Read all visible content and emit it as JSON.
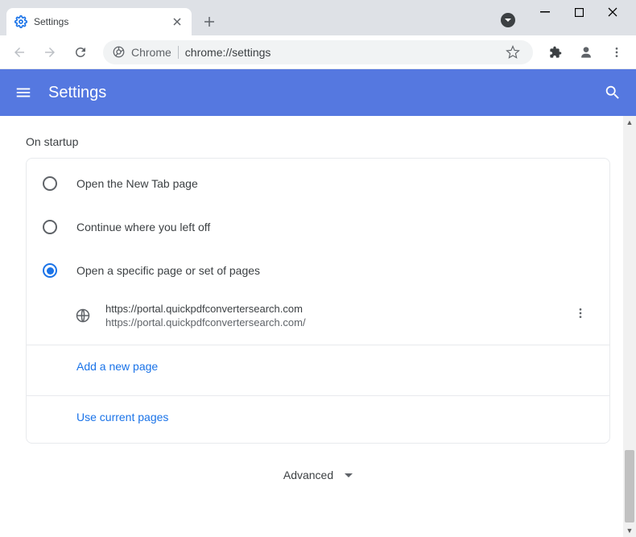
{
  "window": {
    "tab_title": "Settings"
  },
  "omnibox": {
    "prefix": "Chrome",
    "url": "chrome://settings"
  },
  "header": {
    "title": "Settings"
  },
  "section": {
    "title": "On startup",
    "options": [
      {
        "label": "Open the New Tab page"
      },
      {
        "label": "Continue where you left off"
      },
      {
        "label": "Open a specific page or set of pages"
      }
    ],
    "page_entry": {
      "title": "https://portal.quickpdfconvertersearch.com",
      "url": "https://portal.quickpdfconvertersearch.com/"
    },
    "add_link": "Add a new page",
    "use_current_link": "Use current pages"
  },
  "advanced": {
    "label": "Advanced"
  }
}
